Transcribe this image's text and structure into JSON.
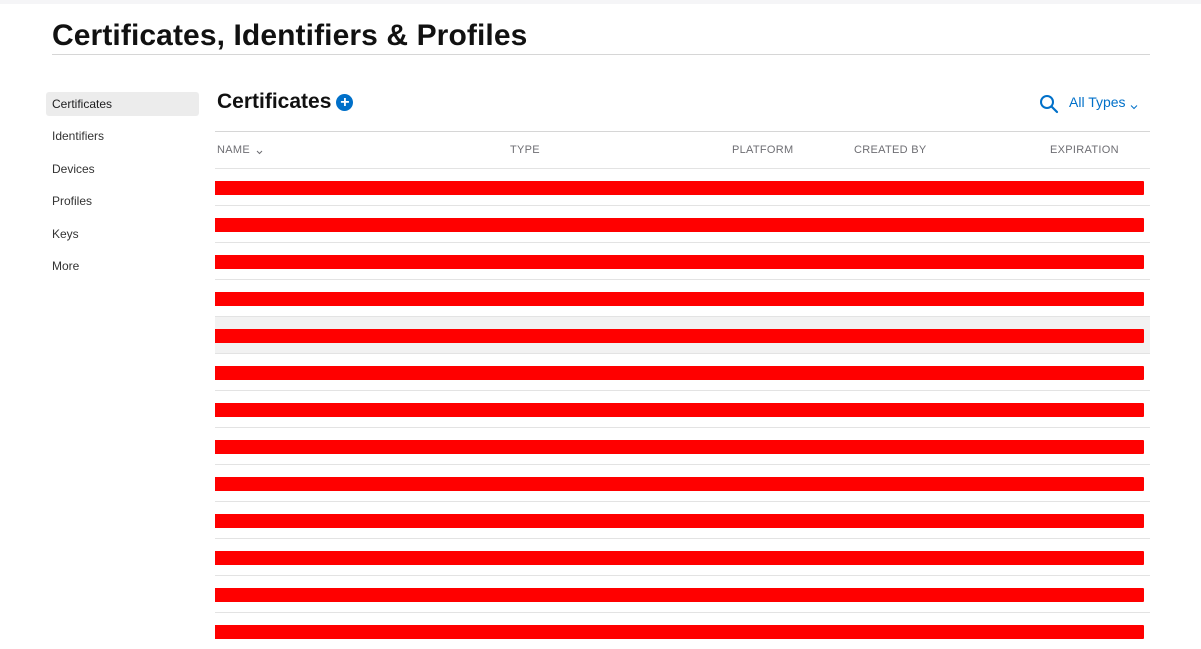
{
  "header": {
    "title": "Certificates, Identifiers & Profiles"
  },
  "sidebar": {
    "items": [
      {
        "label": "Certificates",
        "active": true
      },
      {
        "label": "Identifiers",
        "active": false
      },
      {
        "label": "Devices",
        "active": false
      },
      {
        "label": "Profiles",
        "active": false
      },
      {
        "label": "Keys",
        "active": false
      },
      {
        "label": "More",
        "active": false
      }
    ]
  },
  "section": {
    "title": "Certificates",
    "add_icon": "plus-circle-icon"
  },
  "toolbar": {
    "search_icon": "search-icon",
    "filter_label": "All Types",
    "filter_icon": "chevron-down-icon"
  },
  "table": {
    "columns": {
      "name": "NAME",
      "type": "TYPE",
      "platform": "PLATFORM",
      "created_by": "CREATED BY",
      "expiration": "EXPIRATION"
    },
    "sort_column": "name",
    "rows": [
      {
        "redacted": true,
        "highlighted": false
      },
      {
        "redacted": true,
        "highlighted": false
      },
      {
        "redacted": true,
        "highlighted": false
      },
      {
        "redacted": true,
        "highlighted": false
      },
      {
        "redacted": true,
        "highlighted": true
      },
      {
        "redacted": true,
        "highlighted": false
      },
      {
        "redacted": true,
        "highlighted": false
      },
      {
        "redacted": true,
        "highlighted": false
      },
      {
        "redacted": true,
        "highlighted": false
      },
      {
        "redacted": true,
        "highlighted": false
      },
      {
        "redacted": true,
        "highlighted": false
      },
      {
        "redacted": true,
        "highlighted": false
      },
      {
        "redacted": true,
        "highlighted": false
      }
    ]
  },
  "colors": {
    "accent": "#0070c9",
    "redaction": "#ff0000",
    "active_nav": "#ececec",
    "row_highlight": "#f2f2f2"
  }
}
